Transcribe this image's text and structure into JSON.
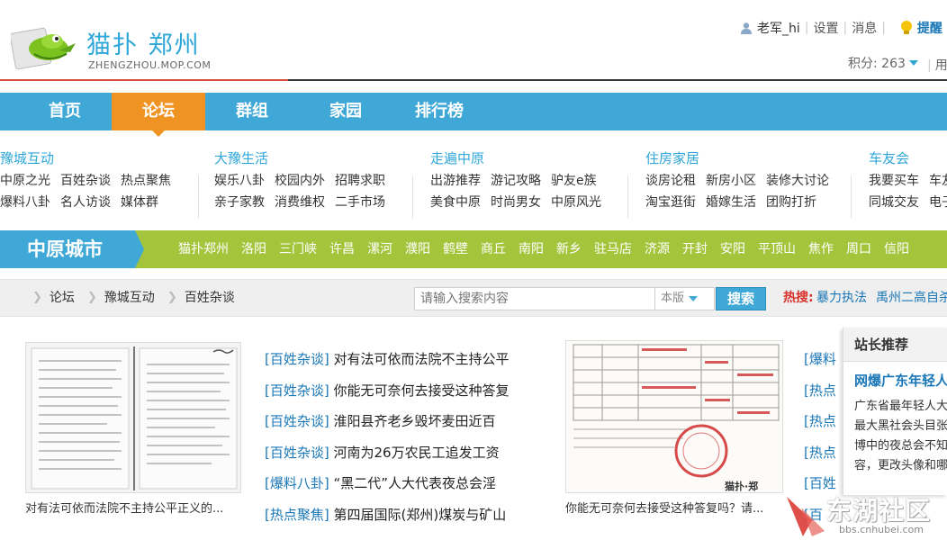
{
  "header": {
    "site_name": "猫扑 郑州",
    "site_domain": "ZHENGZHOU.MOP.COM",
    "username": "老军_hi",
    "settings": "设置",
    "messages": "消息",
    "remind": "提醒",
    "points": "积分: 263",
    "use": "用"
  },
  "main_nav": [
    {
      "label": "首页"
    },
    {
      "label": "论坛"
    },
    {
      "label": "群组"
    },
    {
      "label": "家园"
    },
    {
      "label": "排行榜"
    }
  ],
  "categories": [
    {
      "title": "豫城互动",
      "rows": [
        [
          "中原之光",
          "百姓杂谈",
          "热点聚焦"
        ],
        [
          "爆料八卦",
          "名人访谈",
          "媒体群"
        ]
      ]
    },
    {
      "title": "大豫生活",
      "rows": [
        [
          "娱乐八卦",
          "校园内外",
          "招聘求职"
        ],
        [
          "亲子家教",
          "消费维权",
          "二手市场"
        ]
      ]
    },
    {
      "title": "走遍中原",
      "rows": [
        [
          "出游推荐",
          "游记攻略",
          "驴友e族"
        ],
        [
          "美食中原",
          "时尚男女",
          "中原风光"
        ]
      ]
    },
    {
      "title": "住房家居",
      "rows": [
        [
          "谈房论租",
          "新房小区",
          "装修大讨论"
        ],
        [
          "淘宝逛街",
          "婚嫁生活",
          "团购打折"
        ]
      ]
    },
    {
      "title": "车友会",
      "rows": [
        [
          "我要买车",
          "车友"
        ],
        [
          "同城交友",
          "电子"
        ]
      ]
    }
  ],
  "city_bar": {
    "label": "中原城市",
    "cities": [
      "猫扑郑州",
      "洛阳",
      "三门峡",
      "许昌",
      "漯河",
      "濮阳",
      "鹤壁",
      "商丘",
      "南阳",
      "新乡",
      "驻马店",
      "济源",
      "开封",
      "安阳",
      "平顶山",
      "焦作",
      "周口",
      "信阳"
    ]
  },
  "breadcrumb": [
    "论坛",
    "豫城互动",
    "百姓杂谈"
  ],
  "search": {
    "placeholder": "请输入搜索内容",
    "scope": "本版",
    "button": "搜索",
    "hot_label": "热搜:",
    "hot_links": [
      "暴力执法",
      "禹州二高自杀"
    ]
  },
  "content": {
    "thumb1_caption": "对有法可依而法院不主持公平正义的...",
    "thumb2_caption": "你能无可奈何去接受这种答复吗？请...",
    "posts": [
      {
        "tag": "[百姓杂谈]",
        "title": "对有法可依而法院不主持公平"
      },
      {
        "tag": "[百姓杂谈]",
        "title": "你能无可奈何去接受这种答复"
      },
      {
        "tag": "[百姓杂谈]",
        "title": "淮阳县齐老乡毁坏麦田近百"
      },
      {
        "tag": "[百姓杂谈]",
        "title": "河南为26万农民工追发工资"
      },
      {
        "tag": "[爆料八卦]",
        "title": "“黑二代”人大代表夜总会淫"
      },
      {
        "tag": "[热点聚焦]",
        "title": "第四届国际(郑州)煤炭与矿山"
      }
    ],
    "posts2": [
      "[爆料",
      "[热点",
      "[热点",
      "[热点",
      "[百姓",
      "[百"
    ],
    "doc_stamp": "猫扑·郑"
  },
  "recommend": {
    "head": "站长推荐",
    "title": "网爆广东年轻人",
    "lines": [
      "广东省最年轻人大",
      "最大黑社会头目张",
      "博中的夜总会不知",
      "容，更改头像和哪"
    ]
  },
  "watermark": {
    "text": "东湖社区",
    "sub": "bbs.cnhubei.com"
  },
  "colors": {
    "nav_blue": "#3fa8d6",
    "nav_active": "#ef9422",
    "city_green": "#a4c43c",
    "link_blue": "#1977b8",
    "hot_red": "#d9302a"
  }
}
